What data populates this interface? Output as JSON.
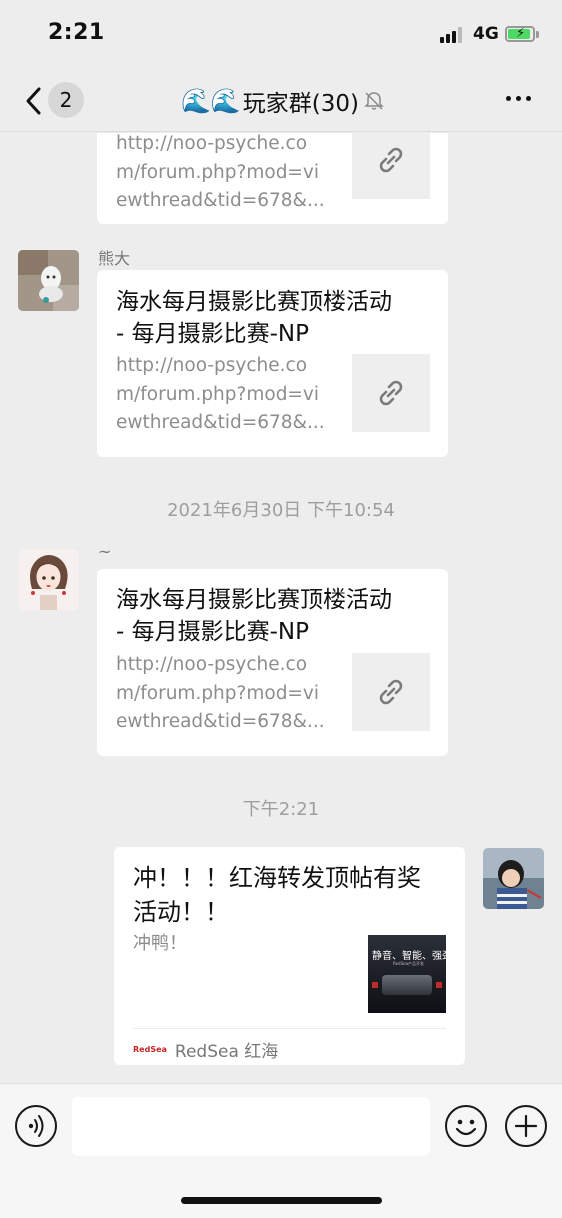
{
  "status_bar": {
    "time": "2:21",
    "network": "4G",
    "battery_charging": true,
    "battery_color": "#4cd964"
  },
  "nav": {
    "back_badge": "2",
    "group_emoji": "🌊🌊",
    "title": "玩家群(30)",
    "muted": true
  },
  "messages": [
    {
      "sender": "",
      "type": "link_card",
      "title": "",
      "desc": "http://noo-psyche.com/forum.php?mod=viewthread&tid=678&...",
      "desc_lines": [
        "http://noo-psyche.co",
        "m/forum.php?mod=vi",
        "ewthread&tid=678&..."
      ]
    },
    {
      "sender": "熊大",
      "type": "link_card",
      "title_lines": [
        "海水每月摄影比赛顶楼活动",
        "- 每月摄影比赛-NP"
      ],
      "desc_lines": [
        "http://noo-psyche.co",
        "m/forum.php?mod=vi",
        "ewthread&tid=678&..."
      ]
    },
    {
      "type": "timestamp",
      "text": "2021年6月30日 下午10:54"
    },
    {
      "sender": "~",
      "type": "link_card",
      "title_lines": [
        "海水每月摄影比赛顶楼活动",
        "- 每月摄影比赛-NP"
      ],
      "desc_lines": [
        "http://noo-psyche.co",
        "m/forum.php?mod=vi",
        "ewthread&tid=678&..."
      ]
    },
    {
      "type": "timestamp",
      "text": "下午2:21"
    },
    {
      "sender": "me",
      "type": "article_card",
      "title_lines": [
        "冲！！！红海转发顶帖有奖",
        "活动！！"
      ],
      "desc": "冲鸭！",
      "thumb_text": "静音、智能、强劲",
      "thumb_sub": "RedSea产品开发",
      "source_logo": "RedSea",
      "source": "RedSea 红海"
    }
  ],
  "input_bar": {
    "placeholder": ""
  }
}
